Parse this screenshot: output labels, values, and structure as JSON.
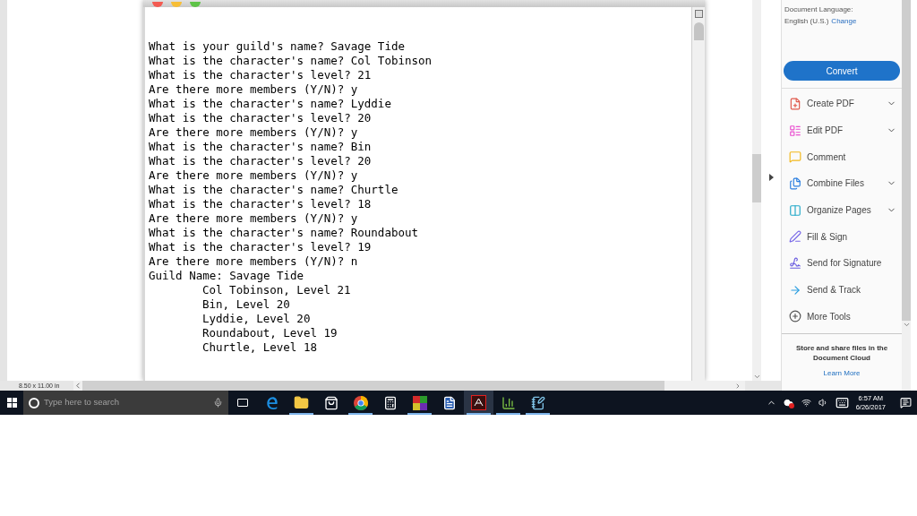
{
  "terminal": {
    "lines": [
      {
        "kind": "line",
        "text": "What is your guild's name? Savage Tide"
      },
      {
        "kind": "line",
        "text": "What is the character's name? Col Tobinson"
      },
      {
        "kind": "line",
        "text": "What is the character's level? 21"
      },
      {
        "kind": "line",
        "text": "Are there more members (Y/N)? y"
      },
      {
        "kind": "line",
        "text": "What is the character's name? Lyddie"
      },
      {
        "kind": "line",
        "text": "What is the character's level? 20"
      },
      {
        "kind": "line",
        "text": "Are there more members (Y/N)? y"
      },
      {
        "kind": "line",
        "text": "What is the character's name? Bin"
      },
      {
        "kind": "line",
        "text": "What is the character's level? 20"
      },
      {
        "kind": "line",
        "text": "Are there more members (Y/N)? y"
      },
      {
        "kind": "line",
        "text": "What is the character's name? Churtle"
      },
      {
        "kind": "line",
        "text": "What is the character's level? 18"
      },
      {
        "kind": "line",
        "text": "Are there more members (Y/N)? y"
      },
      {
        "kind": "line",
        "text": "What is the character's name? Roundabout"
      },
      {
        "kind": "line",
        "text": "What is the character's level? 19"
      },
      {
        "kind": "line",
        "text": "Are there more members (Y/N)? n"
      },
      {
        "kind": "line",
        "text": "Guild Name: Savage Tide"
      },
      {
        "kind": "indented",
        "text": "Col Tobinson, Level 21"
      },
      {
        "kind": "indented",
        "text": "Bin, Level 20"
      },
      {
        "kind": "indented",
        "text": "Lyddie, Level 20"
      },
      {
        "kind": "indented",
        "text": "Roundabout, Level 19"
      },
      {
        "kind": "indented",
        "text": "Churtle, Level 18"
      }
    ]
  },
  "status_bar": {
    "page_size": "8.50 x 11.00 in"
  },
  "tools_pane": {
    "language_label": "Document Language:",
    "language_value": "English (U.S.)",
    "change_link": "Change",
    "convert_button": "Convert",
    "tools": [
      {
        "kind": "create",
        "label": "Create PDF",
        "has_menu": true
      },
      {
        "kind": "edit",
        "label": "Edit PDF",
        "has_menu": true
      },
      {
        "kind": "comment",
        "label": "Comment",
        "has_menu": false
      },
      {
        "kind": "combine",
        "label": "Combine Files",
        "has_menu": true
      },
      {
        "kind": "organize",
        "label": "Organize Pages",
        "has_menu": true
      },
      {
        "kind": "fill",
        "label": "Fill & Sign",
        "has_menu": false
      },
      {
        "kind": "signature",
        "label": "Send for Signature",
        "has_menu": false
      },
      {
        "kind": "track",
        "label": "Send & Track",
        "has_menu": false
      },
      {
        "kind": "more",
        "label": "More Tools",
        "has_menu": false
      }
    ],
    "cloud_text": "Store and share files in the Document Cloud",
    "learn_more": "Learn More"
  },
  "taskbar": {
    "search_placeholder": "Type here to search",
    "apps": [
      {
        "kind": "edge",
        "running": false,
        "selected": false
      },
      {
        "kind": "explorer",
        "running": true,
        "selected": false
      },
      {
        "kind": "store",
        "running": false,
        "selected": false
      },
      {
        "kind": "chrome",
        "running": true,
        "selected": false
      },
      {
        "kind": "calculator",
        "running": false,
        "selected": false
      },
      {
        "kind": "tiles",
        "running": true,
        "selected": false
      },
      {
        "kind": "word",
        "running": false,
        "selected": false
      },
      {
        "kind": "acrobat",
        "running": true,
        "selected": true
      },
      {
        "kind": "chart",
        "running": true,
        "selected": false
      },
      {
        "kind": "notepad",
        "running": true,
        "selected": false
      }
    ],
    "time": "6:57 AM",
    "date": "6/26/2017"
  }
}
